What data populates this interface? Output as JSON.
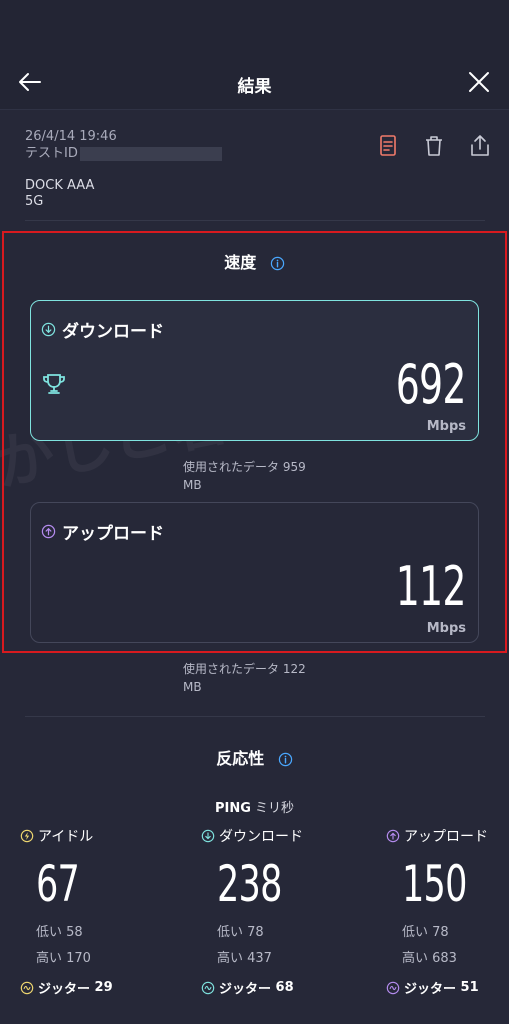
{
  "header": {
    "title": "結果"
  },
  "meta": {
    "datetime": "26/4/14 19:46",
    "test_id_label": "テストID",
    "device_name": "DOCK AAA",
    "network": "5G"
  },
  "speed": {
    "title": "速度",
    "download": {
      "label": "ダウンロード",
      "value": "692",
      "unit": "Mbps",
      "data_used": "使用されたデータ 959 MB"
    },
    "upload": {
      "label": "アップロード",
      "value": "112",
      "unit": "Mbps",
      "data_used": "使用されたデータ 122 MB"
    }
  },
  "responsiveness": {
    "title": "反応性",
    "ping_label": "PING",
    "ping_unit": "ミリ秒",
    "idle": {
      "label": "アイドル",
      "value": "67",
      "low": "低い 58",
      "high": "高い 170",
      "jitter_label": "ジッター",
      "jitter": "29"
    },
    "download": {
      "label": "ダウンロード",
      "value": "238",
      "low": "低い 78",
      "high": "高い 437",
      "jitter_label": "ジッター",
      "jitter": "68"
    },
    "upload": {
      "label": "アップロード",
      "value": "150",
      "low": "低い 78",
      "high": "高い 683",
      "jitter_label": "ジッター",
      "jitter": "51"
    }
  },
  "watermark": "かしこ暮らし",
  "colors": {
    "background": "#262838",
    "download_accent": "#7fe3df",
    "upload_accent": "#b58cf0",
    "idle_accent": "#f0d870",
    "report_icon": "#f07a6a",
    "highlight": "#d81a1f",
    "info": "#4aa8ff"
  }
}
